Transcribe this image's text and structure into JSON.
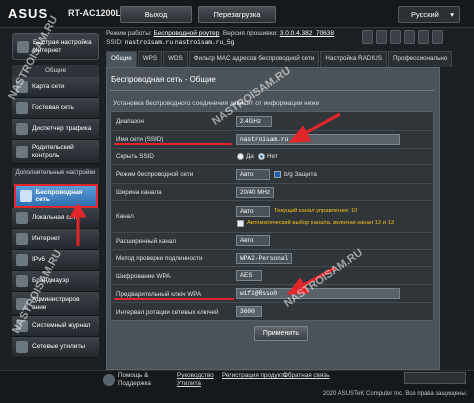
{
  "header": {
    "brand": "ASUS",
    "model": "RT-AC1200L",
    "logout_label": "Выход",
    "reboot_label": "Перезагрузка",
    "language": "Русский",
    "mode_label": "Режим работы:",
    "mode_value": "Беспроводной роутер",
    "firmware_label": "Версия прошивки:",
    "firmware_value": "3.0.0.4.382_70638",
    "ssid_label": "SSID:",
    "ssid_value": "nastroisam.ru",
    "ssid_value_5g": "nastroisam.ru_5g"
  },
  "sidebar": {
    "quick_setup": "Быстрая настройка Интернет",
    "general_title": "Общие",
    "items_general": [
      {
        "label": "Карта сети"
      },
      {
        "label": "Гостевая сеть"
      },
      {
        "label": "Диспетчер трафика"
      },
      {
        "label": "Родительский контроль"
      }
    ],
    "advanced_title": "Дополнительные настройки",
    "wireless_item": "Беспроводная сеть",
    "items_advanced": [
      {
        "label": "Локальная сеть"
      },
      {
        "label": "Интернет"
      },
      {
        "label": "IPv6"
      },
      {
        "label": "Брандмауэр"
      },
      {
        "label": "Администрирование"
      },
      {
        "label": "Системный журнал"
      },
      {
        "label": "Сетевые утилиты"
      }
    ]
  },
  "tabs": [
    {
      "label": "Общие"
    },
    {
      "label": "WPS"
    },
    {
      "label": "WDS"
    },
    {
      "label": "Фильтр MAC адресов беспроводной сети"
    },
    {
      "label": "Настройка RADIUS"
    },
    {
      "label": "Профессионально"
    }
  ],
  "panel": {
    "title": "Беспроводная сеть - Общие",
    "description": "Установка беспроводного соединения зависит от информации ниже",
    "apply_label": "Применить"
  },
  "form": {
    "band": {
      "label": "Диапазон",
      "value": "2.4GHz"
    },
    "ssid": {
      "label": "Имя сети (SSID)",
      "value": "nastroisam.ru"
    },
    "hide_ssid": {
      "label": "Скрыть SSID",
      "yes": "Да",
      "no": "Нет",
      "selected": "no"
    },
    "mode": {
      "label": "Режим беспроводной сети",
      "value": "Авто",
      "option": "b/g Защита"
    },
    "width": {
      "label": "Ширина канала",
      "value": "20/40 MHz"
    },
    "channel": {
      "label": "Канал",
      "value": "Авто",
      "hint1": "Текущий канал управления: 10",
      "hint2": "Автоматический выбор канала, включая канал 12 и 13"
    },
    "ext_channel": {
      "label": "Расширенный канал",
      "value": "Авто"
    },
    "auth": {
      "label": "Метод проверки подлинности",
      "value": "WPA2-Personal"
    },
    "encryption": {
      "label": "Шифрование WPA",
      "value": "AES"
    },
    "psk": {
      "label": "Предварительный ключ WPA",
      "value": "wifi@Rsso0"
    },
    "rekey": {
      "label": "Интервал ротации сетевых ключей",
      "value": "3600"
    }
  },
  "footer": {
    "help_label": "Помощь & Поддержка",
    "manual": "Руководство",
    "utility": "Утилита",
    "registration": "Регистрация продукта",
    "feedback": "Обратная связь",
    "copyright": "2020 ASUSTeK Computer Inc. Все права защищены."
  },
  "watermarks": [
    "NASTROISAM.RU",
    "NASTROISAM.RU",
    "NASTROISAM.RU",
    "NASTROISAM.RU"
  ],
  "colors": {
    "accent": "#e3262a",
    "active_item": "#3d80c4",
    "hint": "#f3c21a"
  }
}
